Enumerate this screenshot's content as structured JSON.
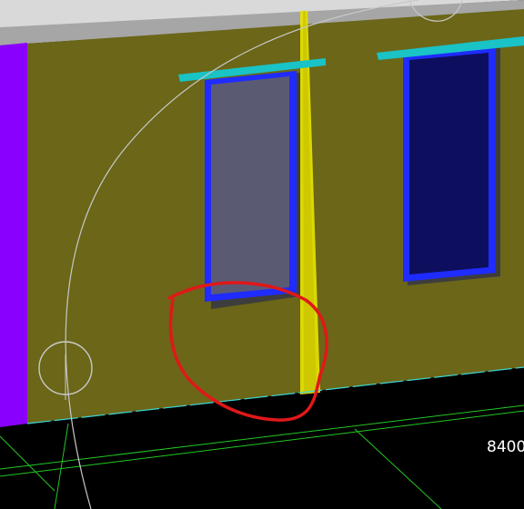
{
  "viewport": {
    "dimension_label": "8400"
  },
  "colors": {
    "background": "#000000",
    "wall": "#6b6618",
    "roof_band": "#a6a6a6",
    "roof_top": "#d9d9d9",
    "left_edge": "#8a00ff",
    "window_frame": "#1f2bff",
    "window_glass_left": "#5b5a73",
    "window_glass_right": "#0d0f5e",
    "window_shadow": "#3d3d3d",
    "lintel": "#19c3c6",
    "markup": "#e01818",
    "yellow_seam": "#e8e400",
    "grid": "#23c823",
    "guide": "#c8c8c8",
    "ground_edge": "#3fd7d7"
  },
  "icons": {
    "snap_marker": "circle-snap-icon"
  }
}
